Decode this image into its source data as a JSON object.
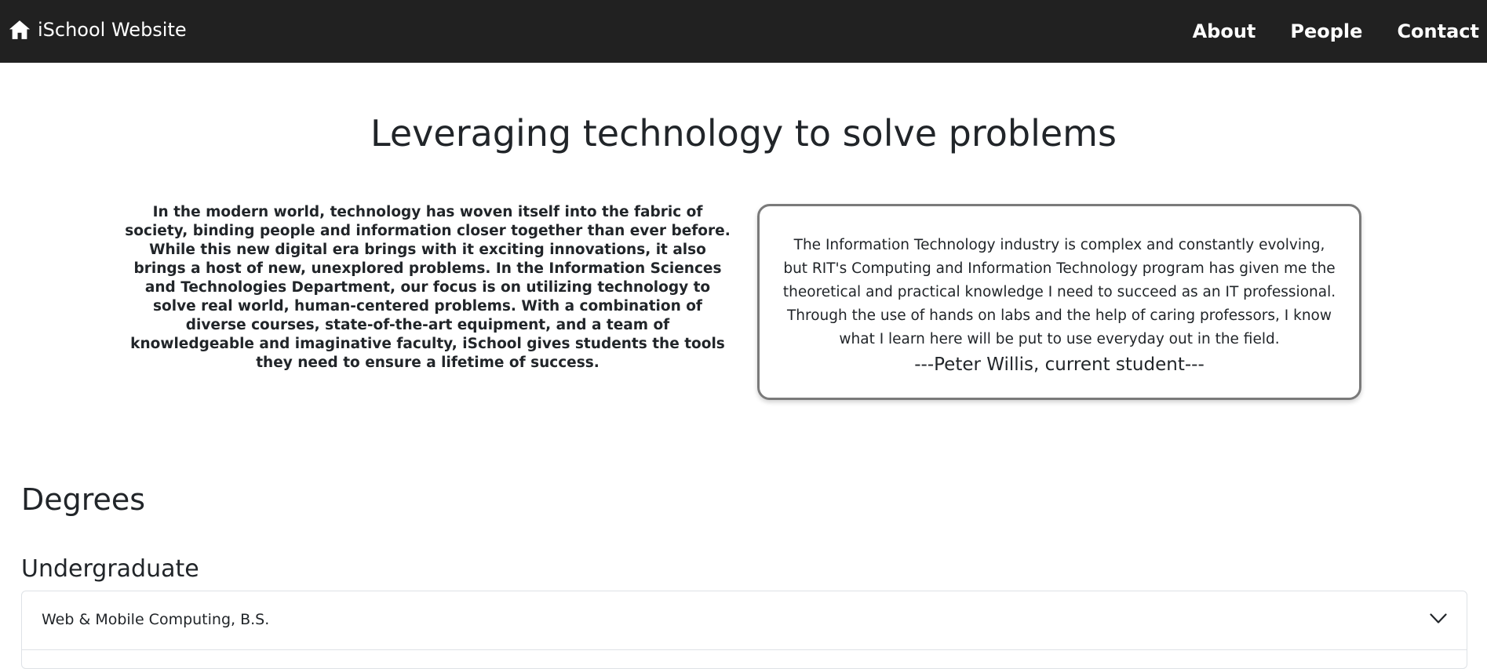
{
  "navbar": {
    "brand_icon": "home-icon",
    "brand_label": "iSchool Website",
    "links": [
      {
        "label": "About"
      },
      {
        "label": "People"
      },
      {
        "label": "Contact"
      }
    ],
    "background_color": "#212121"
  },
  "hero": {
    "title": "Leveraging technology to solve problems"
  },
  "intro": {
    "text": "In the modern world, technology has woven itself into the fabric of society, binding people and information closer together than ever before. While this new digital era brings with it exciting innovations, it also brings a host of new, unexplored problems. In the Information Sciences and Technologies Department, our focus is on utilizing technology to solve real world, human-centered problems. With a combination of diverse courses, state-of-the-art equipment, and a team of knowledgeable and imaginative faculty, iSchool gives students the tools they need to ensure a lifetime of success."
  },
  "testimonial": {
    "quote": "The Information Technology industry is complex and constantly evolving, but RIT's Computing and Information Technology program has given me the theoretical and practical knowledge I need to succeed as an IT professional. Through the use of hands on labs and the help of caring professors, I know what I learn here will be put to use everyday out in the field.",
    "author": "---Peter Willis, current student---"
  },
  "degrees": {
    "heading": "Degrees",
    "undergraduate": {
      "heading": "Undergraduate",
      "items": [
        {
          "label": "Web & Mobile Computing, B.S.",
          "icon": "chevron-down-icon"
        }
      ]
    }
  }
}
